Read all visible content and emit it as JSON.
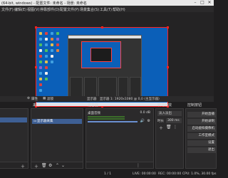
{
  "titlebar": {
    "title": "(64-bit, windows) - 配置文件: 未命名 - 场景: 未命名",
    "min": "–",
    "max": "□",
    "close": "✕"
  },
  "menubar": {
    "items": [
      "文件(F)",
      "编辑(E)",
      "视图(V)",
      "停靠部件(D)",
      "配置文件(P)",
      "场景集合(S)",
      "工具(T)",
      "帮助(H)"
    ]
  },
  "status_row": {
    "settings_label": "属性",
    "filter_label": "滤镜",
    "source_label": "显示器",
    "display_label": "显示器 1: 1920x1080 @ 0,0 (主显示器)"
  },
  "docks": {
    "scenes": {
      "title": "",
      "item": ""
    },
    "sources": {
      "title": "来源",
      "item": "显示器采集"
    },
    "mixer": {
      "title": "混音器",
      "track_name": "桌面音频",
      "track_db": "0.0 dB"
    },
    "transitions": {
      "title": "转场特效",
      "type": "淡入淡出",
      "duration_label": "时长",
      "duration_value": "300 ms"
    },
    "controls": {
      "title": "控制按钮",
      "buttons": [
        "开始直播",
        "开始录制",
        "启动虚拟摄像机",
        "工作室模式",
        "设置",
        "退出"
      ]
    }
  },
  "bottombar": {
    "page": "1 / 1",
    "live": "LIVE: 00:00:00",
    "rec": "REC: 00:00:00",
    "cpu": "CPU: 1.0%, 30.00 fps"
  },
  "colors": {
    "accent": "#3e5f94",
    "selection": "#ff2020",
    "desktop": "#0b5fb8"
  }
}
